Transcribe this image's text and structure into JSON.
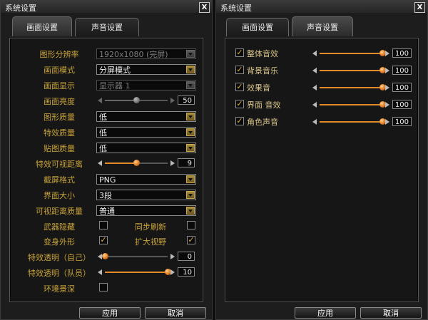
{
  "left": {
    "title": "系统设置",
    "close_label": "X",
    "tabs": [
      {
        "label": "画面设置",
        "active": true
      },
      {
        "label": "声音设置",
        "active": false
      }
    ],
    "rows": {
      "resolution": {
        "label": "图形分辨率",
        "value": "1920x1080 (完屏)",
        "disabled": true
      },
      "screen_mode": {
        "label": "画面模式",
        "value": "分屏模式"
      },
      "display": {
        "label": "画面显示",
        "value": "显示器 1",
        "disabled": true
      },
      "brightness": {
        "label": "画面亮度",
        "value": "50",
        "level": 0.5,
        "disabled": true
      },
      "gfx_quality": {
        "label": "图形质量",
        "value": "低"
      },
      "fx_quality": {
        "label": "特效质量",
        "value": "低"
      },
      "texture_quality": {
        "label": "贴图质量",
        "value": "低"
      },
      "fx_distance": {
        "label": "特效可视距离",
        "value": "9",
        "level": 0.5
      },
      "screenshot_format": {
        "label": "截屏格式",
        "value": "PNG"
      },
      "ui_size": {
        "label": "界面大小",
        "value": "3段"
      },
      "view_distance_quality": {
        "label": "可视距离质量",
        "value": "普通"
      },
      "hide_weapon": {
        "label": "武器隐藏",
        "checked": false
      },
      "sync_refresh": {
        "label": "同步刷新",
        "checked": false
      },
      "transform_look": {
        "label": "变身外形",
        "checked": true
      },
      "wide_view": {
        "label": "扩大视野",
        "checked": true
      },
      "fx_alpha_self": {
        "label": "特效透明（自己）",
        "value": "0",
        "level": 0.0
      },
      "fx_alpha_party": {
        "label": "特效透明（队员）",
        "value": "10",
        "level": 1.0
      },
      "env_depth": {
        "label": "环境景深",
        "checked": false
      }
    },
    "ok_label": "应用",
    "cancel_label": "取消"
  },
  "right": {
    "title": "系统设置",
    "close_label": "X",
    "tabs": [
      {
        "label": "画面设置",
        "active": false
      },
      {
        "label": "声音设置",
        "active": true
      }
    ],
    "items": [
      {
        "label": "整体音效",
        "checked": true,
        "value": "100",
        "level": 1.0
      },
      {
        "label": "背景音乐",
        "checked": true,
        "value": "100",
        "level": 1.0
      },
      {
        "label": "效果音",
        "checked": true,
        "value": "100",
        "level": 1.0
      },
      {
        "label": "界面 音效",
        "checked": true,
        "value": "100",
        "level": 1.0
      },
      {
        "label": "角色声音",
        "checked": true,
        "value": "100",
        "level": 1.0
      }
    ],
    "ok_label": "应用",
    "cancel_label": "取消"
  },
  "colors": {
    "label_gold": "#c9a43a",
    "accent_orange": "#e08a2a"
  }
}
